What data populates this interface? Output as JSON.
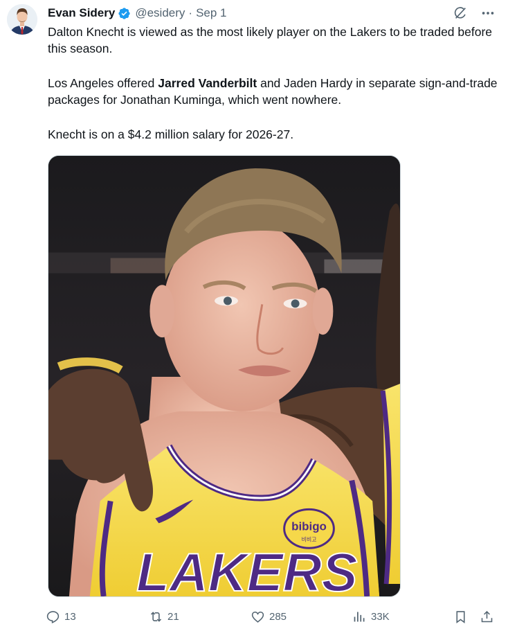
{
  "author": {
    "display_name": "Evan Sidery",
    "handle": "@esidery",
    "separator": "·",
    "date": "Sep 1",
    "verified": true,
    "verified_color": "#1d9bf0"
  },
  "top_actions": {
    "grok_icon": "grok-icon",
    "more_icon": "more-icon"
  },
  "body": {
    "p1": "Dalton Knecht is viewed as the most likely player on the Lakers to be traded before this season.",
    "p2_before": "Los Angeles offered ",
    "p2_bold": "Jarred Vanderbilt",
    "p2_after": " and Jaden Hardy in separate sign-and-trade packages for Jonathan Kuminga, which went nowhere.",
    "p3": "Knecht is on a $4.2 million salary for 2026-27."
  },
  "media": {
    "jersey_wordmark": "LAKERS",
    "patch_text": "bibigo",
    "patch_subtext": "비비고"
  },
  "metrics": {
    "replies": "13",
    "reposts": "21",
    "likes": "285",
    "views": "33K"
  },
  "colors": {
    "text_primary": "#0f1419",
    "text_secondary": "#536471",
    "lakers_gold": "#f6d84a",
    "lakers_purple": "#4e2a84"
  }
}
